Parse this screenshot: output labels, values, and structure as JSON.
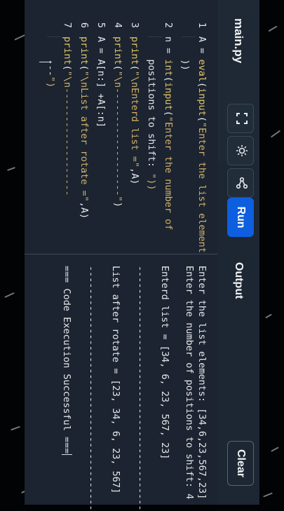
{
  "editor": {
    "file_tab": "main.py",
    "lines": [
      {
        "num": "1",
        "text": "A = eval(input(\"Enter the list elements: \""
      },
      {
        "num": "",
        "text": "    ))"
      },
      {
        "num": "2",
        "text": "n = int(input(\"Enter the number of"
      },
      {
        "num": "",
        "text": "    positions to shift: \"))"
      },
      {
        "num": "3",
        "text": "print(\"\\nEnterd list =\",A)"
      },
      {
        "num": "4",
        "text": "print(\"\\n-------------------\")"
      },
      {
        "num": "5",
        "text": "A = A[n:] +A[:n]"
      },
      {
        "num": "6",
        "text": "print(\"\\nList after rotate =\",A)"
      },
      {
        "num": "7",
        "text": "print(\"\\n-------------------"
      },
      {
        "num": "",
        "text": "    ---\")"
      }
    ]
  },
  "toolbar": {
    "fullscreen_icon": "expand-icon",
    "theme_icon": "sun-icon",
    "share_icon": "share-icon",
    "run_label": "Run",
    "output_label": "Output",
    "clear_label": "Clear"
  },
  "output": {
    "lines": [
      "Enter the list elements: [34,6,23,567,23]",
      "Enter the number of positions to shift: 4",
      "",
      "Enterd list = [34, 6, 23, 567, 23]",
      "",
      "-------------------------------------------",
      "",
      "List after rotate = [23, 34, 6, 23, 567]",
      "",
      "-------------------------------------------",
      "",
      "=== Code Execution Successful ==="
    ]
  },
  "colors": {
    "run_button": "#0d5fe0",
    "panel": "#1b2430",
    "keyword_yellow": "#e8c66a",
    "string_gold": "#d4b06a"
  }
}
